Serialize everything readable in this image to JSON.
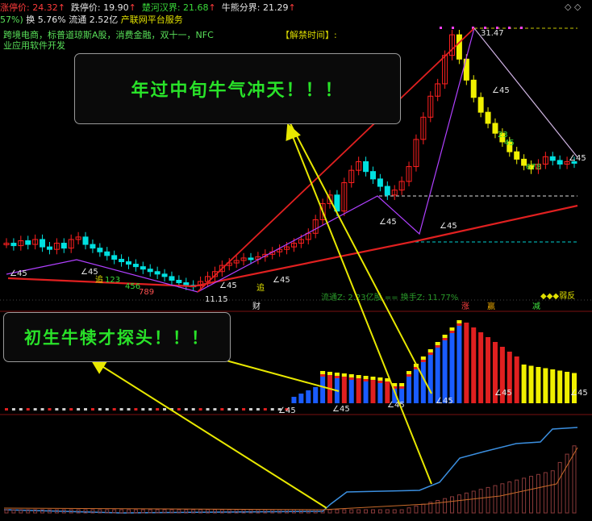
{
  "header": {
    "limit_up_label": "涨停价: 24.32",
    "limit_down_label": "跌停价: 19.90",
    "chu_han_label": "楚河汉界: 21.68",
    "bull_bear_label": "牛熊分界: 21.29",
    "turnover_label": "换 5.76%",
    "float_label": "流通 2.52亿",
    "pct_fragment": "57%)",
    "industry_label": "产联网平台服务",
    "concepts": "跨境电商，标普道琼斯A股，消费金融，双十一，NFC",
    "concepts2": "业应用软件开发",
    "unlock_label": "【解禁时间】:",
    "corner_icons": "◇ ◇"
  },
  "annotations": {
    "top_box": "年过中旬牛气冲天！！！",
    "bottom_box": "初生牛犊才探头！！！"
  },
  "price_labels": {
    "high": "31.47",
    "low": "11.15",
    "angle": "∠45",
    "zhui": "追",
    "cai": "财",
    "zhang": "涨",
    "ying": "赢",
    "jian": "减",
    "diamonds": "◆◆◆弱反",
    "flow_text": "流通Z: 2.23亿股 == 换手Z: 11.77%"
  },
  "colors": {
    "up": "#ff2020",
    "down": "#00e0e0",
    "yellow": "#f0f000",
    "blue": "#1a5cff",
    "magenta": "#b040ff",
    "arrow": "#e8e800",
    "green_text": "#29e329"
  },
  "chart_data": {
    "type": "candlestick",
    "title": "",
    "panels": [
      "price",
      "volume_indicator",
      "cumulative_indicator"
    ],
    "price": {
      "limit_up": 24.32,
      "limit_down": 19.9,
      "chu_han_jie": 21.68,
      "bull_bear": 21.29,
      "high_marker": 31.47,
      "low_marker": 11.15,
      "close_series_approx": [
        14.6,
        14.4,
        14.8,
        14.5,
        14.9,
        14.3,
        14.1,
        14.6,
        14.2,
        14.9,
        15.1,
        14.5,
        14.2,
        13.9,
        13.6,
        13.3,
        13.1,
        12.9,
        12.7,
        12.5,
        12.3,
        12.1,
        11.9,
        11.6,
        11.4,
        11.2,
        11.15,
        11.5,
        11.9,
        12.3,
        12.8,
        13.0,
        13.2,
        13.4,
        13.3,
        13.5,
        13.7,
        13.9,
        14.1,
        14.3,
        14.6,
        14.9,
        15.4,
        16.5,
        17.8,
        18.5,
        17.2,
        19.5,
        20.5,
        21.2,
        20.4,
        19.8,
        19.2,
        18.5,
        18.9,
        19.6,
        20.8,
        23.0,
        24.8,
        26.5,
        27.5,
        29.8,
        31.47,
        29.5,
        27.8,
        26.4,
        25.2,
        24.3,
        23.5,
        22.8,
        22.0,
        21.4,
        20.9,
        20.6,
        21.0,
        21.6,
        21.3,
        21.0,
        21.2,
        21.1
      ]
    }
  }
}
